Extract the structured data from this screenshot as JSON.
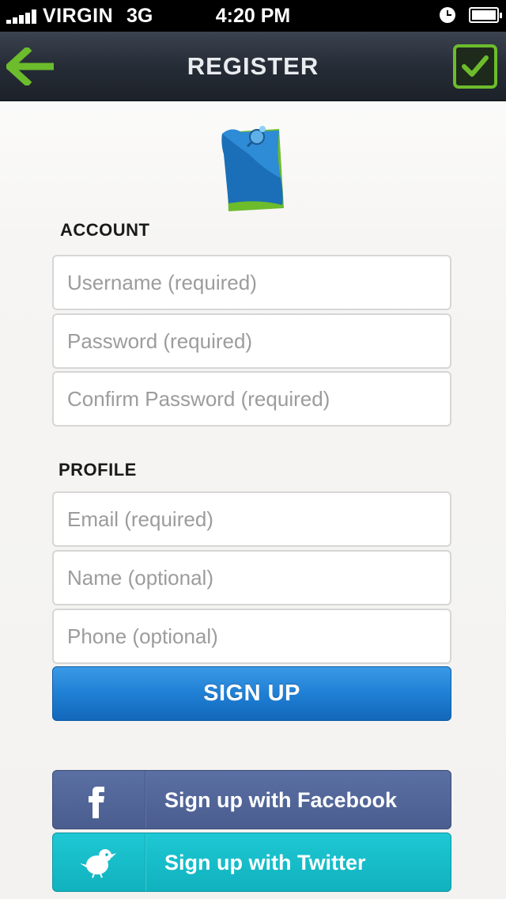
{
  "status_bar": {
    "carrier": "VIRGIN",
    "network": "3G",
    "time": "4:20 PM"
  },
  "nav": {
    "title": "REGISTER",
    "back_icon": "arrow-left-icon",
    "confirm_icon": "checkmark-icon"
  },
  "logo": {
    "icon": "pinned-note-icon"
  },
  "account": {
    "heading": "ACCOUNT",
    "username_placeholder": "Username (required)",
    "password_placeholder": "Password (required)",
    "confirm_password_placeholder": "Confirm Password (required)"
  },
  "profile": {
    "heading": "PROFILE",
    "email_placeholder": "Email (required)",
    "name_placeholder": "Name (optional)",
    "phone_placeholder": "Phone (optional)"
  },
  "signup_button": {
    "label": "SIGN UP"
  },
  "social": {
    "facebook_label": "Sign up with Facebook",
    "facebook_icon": "facebook-f-icon",
    "twitter_label": "Sign up with Twitter",
    "twitter_icon": "twitter-bird-icon"
  },
  "colors": {
    "accent_green": "#6cbc2c",
    "primary_blue": "#1f7fd4",
    "facebook_blue": "#4f6399",
    "twitter_teal": "#15bdc8",
    "nav_dark": "#262c36"
  }
}
